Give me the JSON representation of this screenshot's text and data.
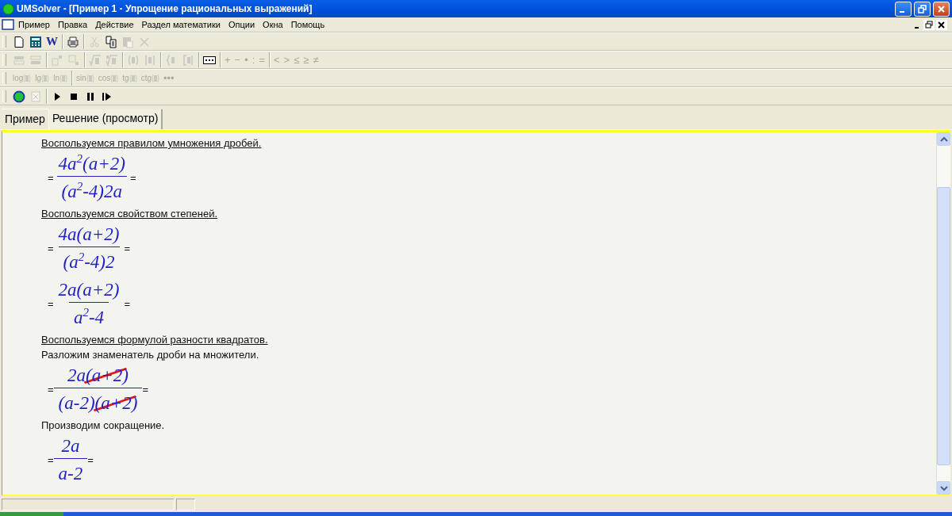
{
  "window": {
    "title": "UMSolver - [Пример 1 - Упрощение рациональных выражений]"
  },
  "menu": [
    "Пример",
    "Правка",
    "Действие",
    "Раздел математики",
    "Опции",
    "Окна",
    "Помощь"
  ],
  "toolbars": [
    {
      "groups": [
        [
          {
            "kind": "new",
            "disabled": false
          },
          {
            "kind": "calc",
            "disabled": false
          },
          {
            "kind": "letter",
            "label": "W",
            "disabled": false
          }
        ],
        [
          {
            "kind": "preview",
            "disabled": false
          }
        ],
        [
          {
            "kind": "cut",
            "disabled": true
          },
          {
            "kind": "copy",
            "disabled": false
          },
          {
            "kind": "paste",
            "disabled": true
          },
          {
            "kind": "delete",
            "disabled": true
          }
        ]
      ]
    },
    {
      "groups": [
        [
          {
            "kind": "row-insert",
            "disabled": true
          },
          {
            "kind": "row-delete",
            "disabled": true
          }
        ],
        [
          {
            "kind": "superscript",
            "disabled": true
          },
          {
            "kind": "subscript",
            "disabled": true
          }
        ],
        [
          {
            "kind": "root",
            "disabled": true
          },
          {
            "kind": "root-index",
            "disabled": true
          }
        ],
        [
          {
            "kind": "paren",
            "disabled": true
          },
          {
            "kind": "abs",
            "disabled": true
          }
        ],
        [
          {
            "kind": "brace",
            "disabled": true
          },
          {
            "kind": "bracket",
            "disabled": true
          }
        ],
        [
          {
            "kind": "ellipsis-box",
            "disabled": false
          }
        ],
        [
          {
            "kind": "symbol",
            "label": "+",
            "disabled": true
          },
          {
            "kind": "symbol",
            "label": "−",
            "disabled": true
          },
          {
            "kind": "symbol",
            "label": "•",
            "disabled": true
          },
          {
            "kind": "symbol",
            "label": ":",
            "disabled": true
          },
          {
            "kind": "symbol",
            "label": "=",
            "disabled": true
          }
        ],
        [
          {
            "kind": "symbol",
            "label": "<",
            "disabled": true
          },
          {
            "kind": "symbol",
            "label": ">",
            "disabled": true
          },
          {
            "kind": "symbol",
            "label": "≤",
            "disabled": true
          },
          {
            "kind": "symbol",
            "label": "≥",
            "disabled": true
          },
          {
            "kind": "symbol",
            "label": "≠",
            "disabled": true
          }
        ]
      ]
    },
    {
      "groups": [
        [
          {
            "kind": "function",
            "label": "log",
            "disabled": true
          },
          {
            "kind": "function",
            "label": "lg",
            "disabled": true
          },
          {
            "kind": "function",
            "label": "ln",
            "disabled": true
          }
        ],
        [
          {
            "kind": "function",
            "label": "sin",
            "disabled": true
          },
          {
            "kind": "function",
            "label": "cos",
            "disabled": true
          },
          {
            "kind": "function",
            "label": "tg",
            "disabled": true
          },
          {
            "kind": "function",
            "label": "ctg",
            "disabled": true
          },
          {
            "kind": "symbol",
            "label": "•••",
            "disabled": true
          }
        ]
      ]
    },
    {
      "groups": [
        [
          {
            "kind": "record",
            "disabled": false
          },
          {
            "kind": "close-doc",
            "disabled": true
          }
        ],
        [
          {
            "kind": "play",
            "disabled": false
          },
          {
            "kind": "stop",
            "disabled": false
          },
          {
            "kind": "pause",
            "disabled": false
          },
          {
            "kind": "step",
            "disabled": false
          }
        ]
      ]
    }
  ],
  "tabs": [
    {
      "label": "Пример",
      "selected": false
    },
    {
      "label": "Решение (просмотр)",
      "selected": true
    }
  ],
  "steps": [
    {
      "kind": "rule",
      "text": "Воспользуемся правилом умножения дробей."
    },
    {
      "kind": "fraction",
      "lead": "=",
      "numerator": [
        {
          "text": "4a$^{2}$(a+2)",
          "struck": false
        }
      ],
      "denominator": [
        {
          "text": "(a$^{2}$-4)2a",
          "struck": false
        }
      ],
      "trail": "="
    },
    {
      "kind": "rule",
      "text": "Воспользуемся свойством степеней."
    },
    {
      "kind": "fraction",
      "lead": "=",
      "numerator": [
        {
          "text": "4a(a+2)",
          "struck": false
        }
      ],
      "denominator": [
        {
          "text": "(a$^{2}$-4)2",
          "struck": false
        }
      ],
      "trail": "="
    },
    {
      "kind": "fraction",
      "lead": "=",
      "numerator": [
        {
          "text": "2a(a+2)",
          "struck": false
        }
      ],
      "denominator": [
        {
          "text": "a$^{2}$-4",
          "struck": false
        }
      ],
      "trail": "="
    },
    {
      "kind": "rule",
      "text": "Воспользуемся формулой разности квадратов."
    },
    {
      "kind": "text",
      "text": "Разложим знаменатель дроби на множители."
    },
    {
      "kind": "fraction",
      "lead": "=",
      "numerator": [
        {
          "text": "2a",
          "struck": false
        },
        {
          "text": "(a+2)",
          "struck": true
        }
      ],
      "denominator": [
        {
          "text": "(a-2)",
          "struck": false
        },
        {
          "text": "(a+2)",
          "struck": true
        }
      ],
      "trail": "="
    },
    {
      "kind": "text",
      "text": "Производим сокращение."
    },
    {
      "kind": "fraction",
      "lead": "=",
      "numerator": [
        {
          "text": "2a",
          "struck": false
        }
      ],
      "denominator": [
        {
          "text": "a-2",
          "struck": false
        }
      ],
      "trail": "="
    }
  ]
}
